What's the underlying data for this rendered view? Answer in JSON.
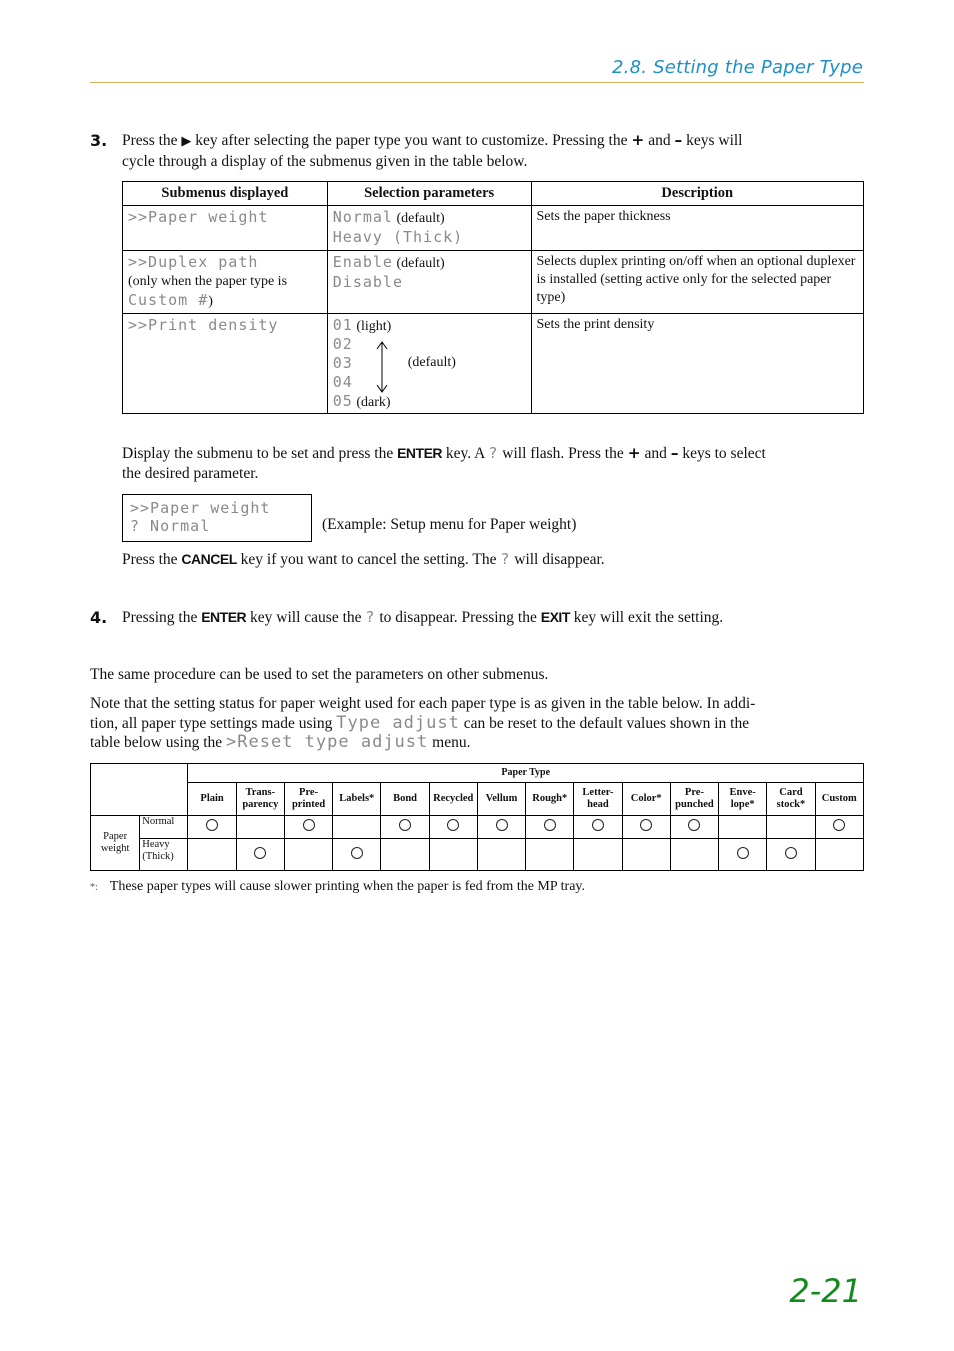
{
  "header": {
    "section_title": "2.8. Setting the Paper Type",
    "accent_color": "#1e8fc8",
    "rule_color": "#c9b25a"
  },
  "step3": {
    "number": "3.",
    "line1_before_arrow": "Press the ",
    "arrow_icon": "▶",
    "line1_after_arrow": " key after selecting the paper type you want to customize. Pressing the ",
    "plus": "+",
    "and": " and ",
    "minus": "–",
    "line1_end": " keys will",
    "line2": "cycle through a display of the submenus given in the table below."
  },
  "submenu_table": {
    "headers": [
      "Submenus displayed",
      "Selection parameters",
      "Description"
    ],
    "rows": [
      {
        "submenu": ">>Paper weight",
        "params": [
          {
            "lcd": "Normal",
            "note": "(default)"
          },
          {
            "lcd": "Heavy (Thick)",
            "note": ""
          }
        ],
        "description": "Sets the paper thickness"
      },
      {
        "submenu": ">>Duplex path",
        "submenu_note_pre": "(only when the paper type is ",
        "submenu_note_lcd": "Custom #",
        "submenu_note_post": ")",
        "params": [
          {
            "lcd": "Enable",
            "note": "(default)"
          },
          {
            "lcd": "Disable",
            "note": ""
          }
        ],
        "description": "Selects duplex printing on/off when an optional duplexer is installed (setting active only for the selected paper type)"
      },
      {
        "submenu": ">>Print density",
        "params": [
          {
            "lcd": "01",
            "note": "(light)"
          },
          {
            "lcd": "02",
            "note": ""
          },
          {
            "lcd": "03",
            "note": ""
          },
          {
            "lcd": "04",
            "note": ""
          },
          {
            "lcd": "05",
            "note": "(dark)"
          }
        ],
        "range_note": "(default)",
        "description": "Sets the print density"
      }
    ]
  },
  "instructions": {
    "p1_a": "Display the submenu to be set and press the ",
    "key_enter": "ENTER",
    "p1_b": " key. A ",
    "qmark": "?",
    "p1_c": " will flash. Press the ",
    "plus": "+",
    "p1_d": " and ",
    "minus": "–",
    "p1_e": " keys to select",
    "p1_line2": "the desired parameter.",
    "example_line1": ">>Paper weight",
    "example_line2": "? Normal",
    "example_caption": "(Example: Setup menu for Paper weight)",
    "p2_a": "Press the ",
    "key_cancel": "CANCEL",
    "p2_b": " key if you want to cancel the setting. The ",
    "p2_c": " will disappear."
  },
  "step4": {
    "number": "4.",
    "a": "Pressing the ",
    "key_enter": "ENTER",
    "b": " key will cause the ",
    "qmark": "?",
    "c": " to disappear. Pressing the ",
    "key_exit": "EXIT",
    "d": " key will exit the setting."
  },
  "body": {
    "same_procedure": "The same procedure can be used to set the parameters on other submenus.",
    "note_a": "Note that the setting status for paper weight used for each paper type is as given in the table below. In addi-",
    "note_b": "tion, all paper type settings made using ",
    "note_lcd1": "Type adjust",
    "note_c": " can be reset to the default values shown in the",
    "note_d": "table below using the ",
    "note_lcd2": ">Reset type adjust",
    "note_e": " menu."
  },
  "paper_table": {
    "group_header": "Paper Type",
    "row_group_label": "Paper weight",
    "columns": [
      {
        "l1": "Plain",
        "l2": ""
      },
      {
        "l1": "Trans-",
        "l2": "parency"
      },
      {
        "l1": "Pre-",
        "l2": "printed"
      },
      {
        "l1": "Labels*",
        "l2": ""
      },
      {
        "l1": "Bond",
        "l2": ""
      },
      {
        "l1": "Recycled",
        "l2": ""
      },
      {
        "l1": "Vellum",
        "l2": ""
      },
      {
        "l1": "Rough*",
        "l2": ""
      },
      {
        "l1": "Letter-",
        "l2": "head"
      },
      {
        "l1": "Color*",
        "l2": ""
      },
      {
        "l1": "Pre-",
        "l2": "punched"
      },
      {
        "l1": "Enve-",
        "l2": "lope*"
      },
      {
        "l1": "Card",
        "l2": "stock*"
      },
      {
        "l1": "Custom",
        "l2": ""
      }
    ],
    "rows": [
      {
        "label_l1": "Normal",
        "label_l2": "",
        "marks": [
          true,
          false,
          true,
          false,
          true,
          true,
          true,
          true,
          true,
          true,
          true,
          false,
          false,
          true
        ]
      },
      {
        "label_l1": "Heavy",
        "label_l2": "(Thick)",
        "marks": [
          false,
          true,
          false,
          true,
          false,
          false,
          false,
          false,
          false,
          false,
          false,
          true,
          true,
          false
        ]
      }
    ]
  },
  "footnote": {
    "mark": "*:",
    "text": "These paper types will cause slower printing when the paper is fed from the MP tray."
  },
  "page_number": "2-21"
}
